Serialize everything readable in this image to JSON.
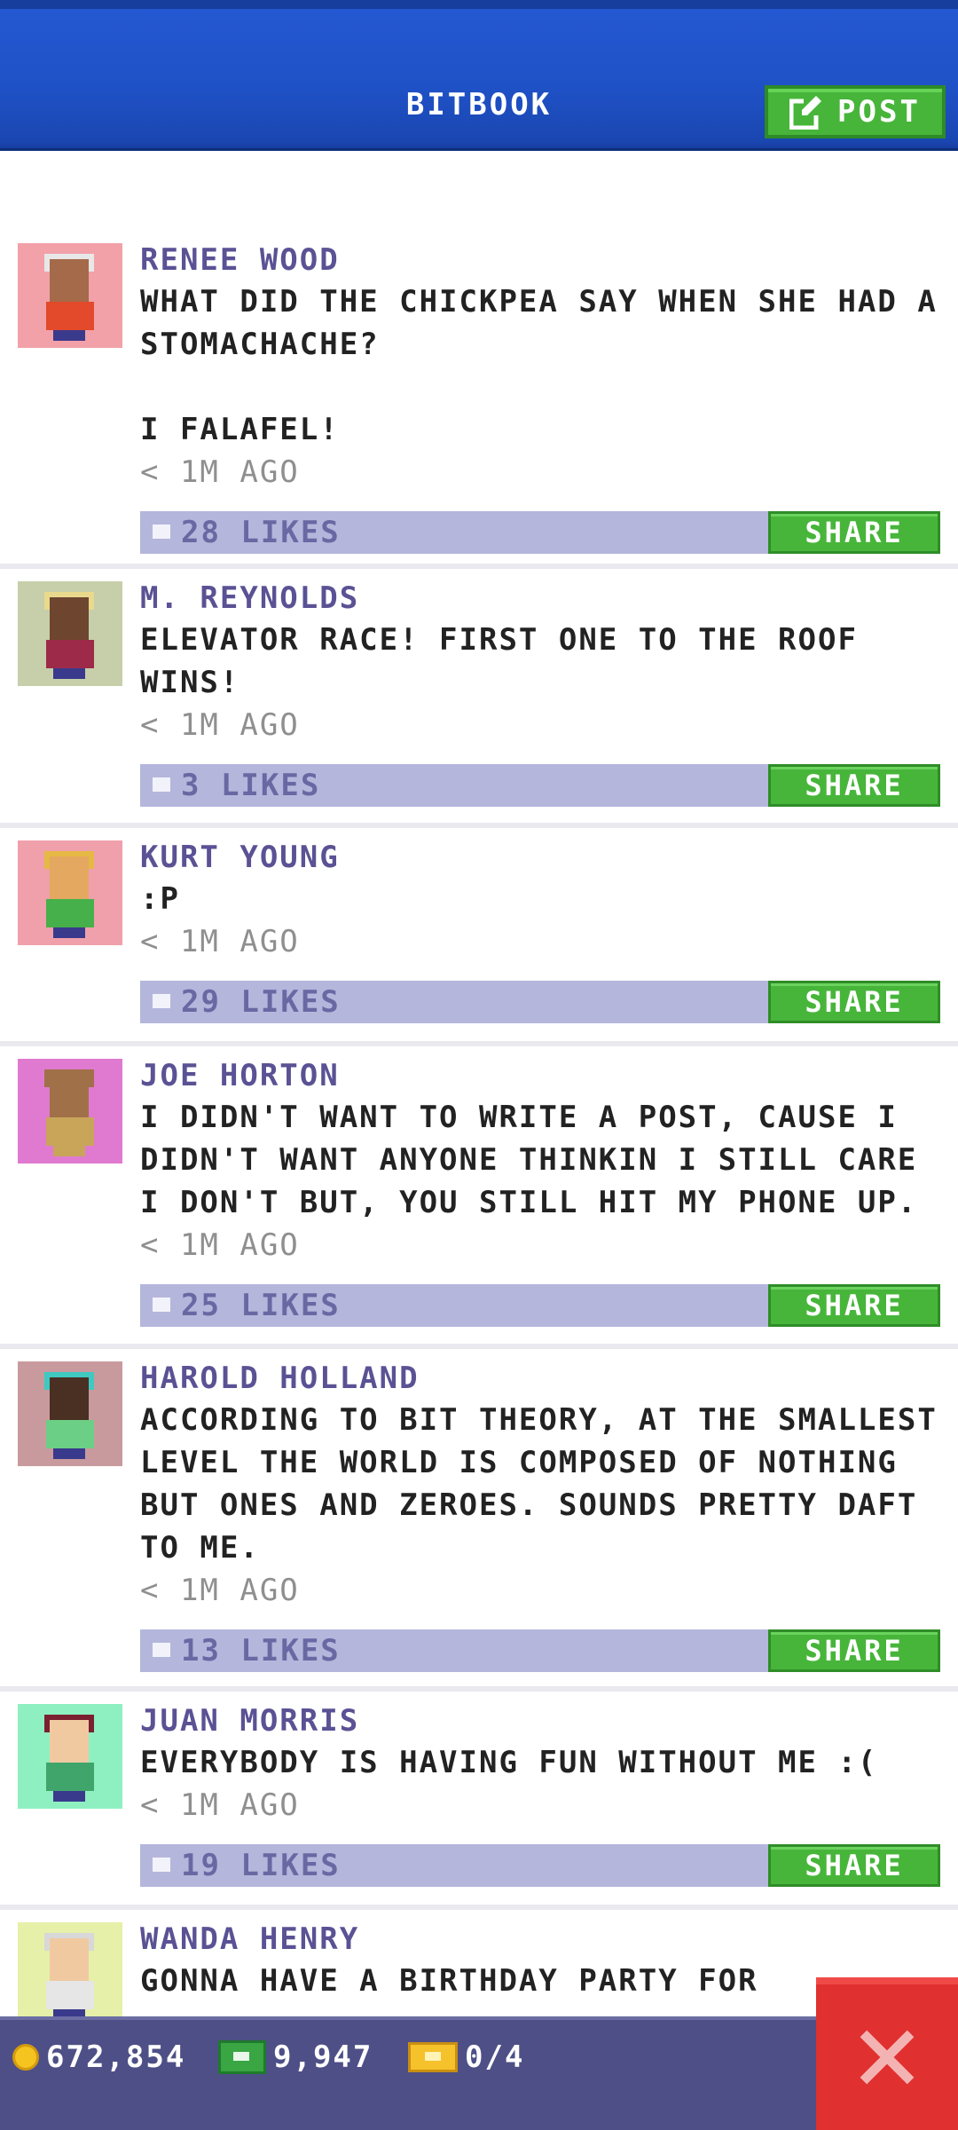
{
  "header": {
    "title": "BITBOOK",
    "post_label": "POST"
  },
  "colors": {
    "header_blue": "#1f51c6",
    "share_green": "#47b53a",
    "likebar_lavender": "#b5b6dc",
    "name_purple": "#5a5294",
    "close_red": "#e0302f"
  },
  "posts": [
    {
      "name": "RENEE WOOD",
      "text": "WHAT DID THE CHICKPEA SAY WHEN SHE HAD A STOMACHACHE?\n\nI FALAFEL!",
      "time": "< 1M AGO",
      "likes": "28 LIKES",
      "share": "SHARE",
      "avatar": {
        "bg": "#f2a1a9",
        "skin": "#a56a49",
        "shirt": "#e24a2b",
        "hair": "#e8e8e8"
      }
    },
    {
      "name": "M. REYNOLDS",
      "text": "ELEVATOR RACE! FIRST ONE TO THE ROOF WINS!",
      "time": "< 1M AGO",
      "likes": "3 LIKES",
      "share": "SHARE",
      "avatar": {
        "bg": "#c6cfa9",
        "skin": "#6e4630",
        "shirt": "#9e2a4a",
        "hair": "#e9d98c"
      }
    },
    {
      "name": "KURT YOUNG",
      "text": ":P",
      "time": "< 1M AGO",
      "likes": "29 LIKES",
      "share": "SHARE",
      "avatar": {
        "bg": "#f0a0aa",
        "skin": "#e4a860",
        "shirt": "#46b04a",
        "hair": "#e6b845"
      }
    },
    {
      "name": "JOE HORTON",
      "text": "I DIDN'T WANT TO WRITE A POST, CAUSE I DIDN'T WANT ANYONE THINKIN I STILL CARE I DON'T BUT, YOU STILL HIT MY PHONE UP.",
      "time": "< 1M AGO",
      "likes": "25 LIKES",
      "share": "SHARE",
      "avatar": {
        "bg": "#e07ad0",
        "skin": "#a07048",
        "shirt": "#c9a55a",
        "hair": "#a07048"
      }
    },
    {
      "name": "HAROLD HOLLAND",
      "text": "ACCORDING TO BIT THEORY, AT THE SMALLEST LEVEL THE WORLD IS COMPOSED OF NOTHING BUT ONES AND ZEROES. SOUNDS PRETTY DAFT TO ME.",
      "time": "< 1M AGO",
      "likes": "13 LIKES",
      "share": "SHARE",
      "avatar": {
        "bg": "#c99a9d",
        "skin": "#4a3022",
        "shirt": "#6ccf86",
        "hair": "#3fc9c0"
      }
    },
    {
      "name": "JUAN MORRIS",
      "text": "EVERYBODY IS HAVING FUN WITHOUT ME :(",
      "time": "< 1M AGO",
      "likes": "19 LIKES",
      "share": "SHARE",
      "avatar": {
        "bg": "#8ef0c0",
        "skin": "#f1c9a1",
        "shirt": "#3fa56b",
        "hair": "#7a2030"
      }
    },
    {
      "name": "WANDA HENRY",
      "text": "GONNA HAVE A BIRTHDAY PARTY FOR",
      "time": "",
      "likes": "",
      "share": "",
      "avatar": {
        "bg": "#e6f0a8",
        "skin": "#f1c9a1",
        "shirt": "#e6e6e6",
        "hair": "#d8d8d8"
      }
    }
  ],
  "bottom": {
    "coins": "672,854",
    "bux": "9,947",
    "tickets": "0/4"
  }
}
